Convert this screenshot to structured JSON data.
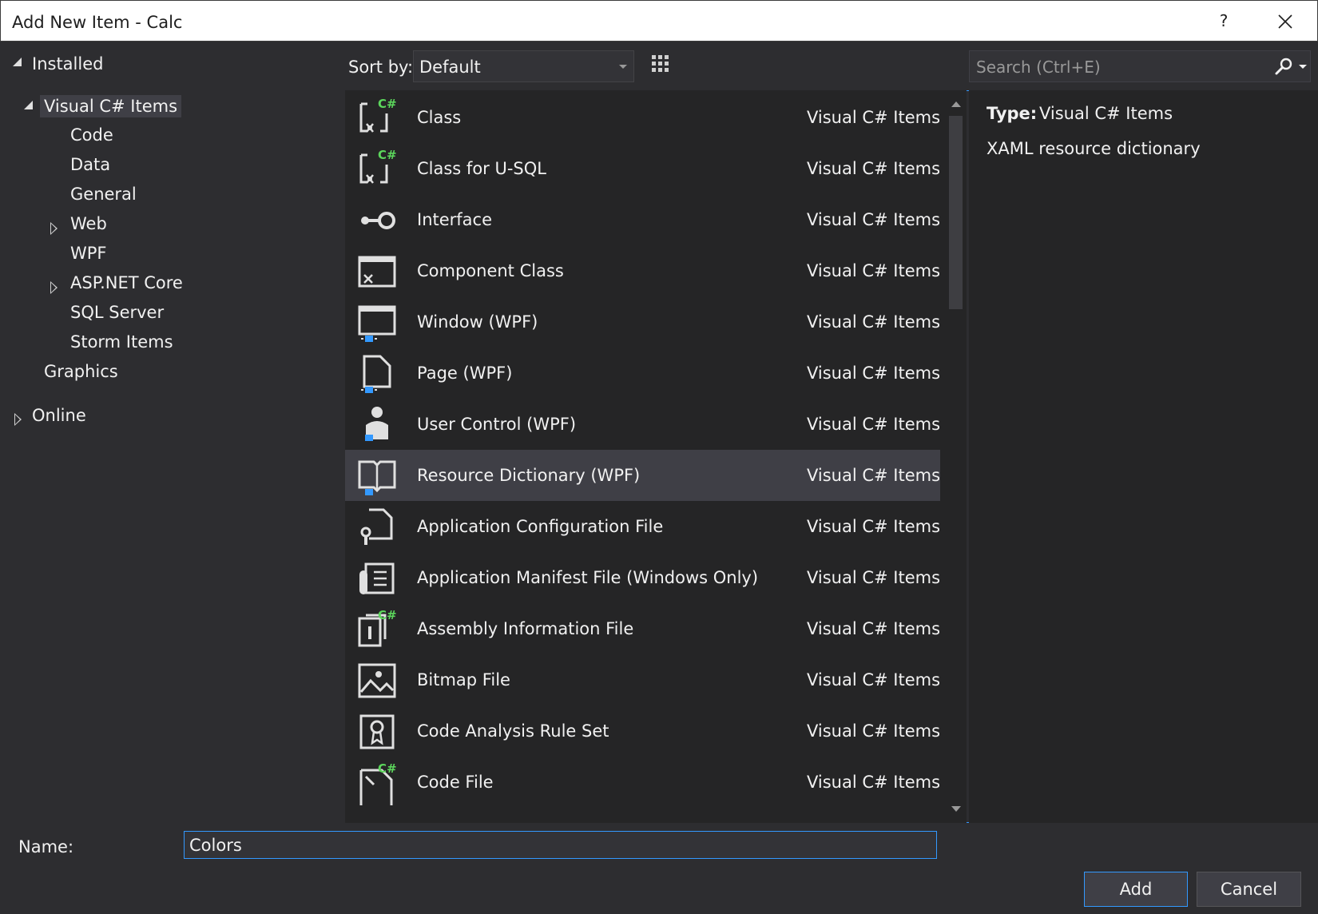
{
  "window": {
    "title": "Add New Item - Calc",
    "help_label": "?"
  },
  "tree": {
    "installed": "Installed",
    "visual_cs_items": "Visual C# Items",
    "children": [
      "Code",
      "Data",
      "General",
      "Web",
      "WPF",
      "ASP.NET Core",
      "SQL Server",
      "Storm Items"
    ],
    "graphics": "Graphics",
    "online": "Online"
  },
  "toolbar": {
    "sort_label": "Sort by:",
    "sort_value": "Default",
    "search_placeholder": "Search (Ctrl+E)"
  },
  "templates": [
    {
      "name": "Class",
      "type": "Visual C# Items",
      "icon": "class-icon"
    },
    {
      "name": "Class for U-SQL",
      "type": "Visual C# Items",
      "icon": "class-icon"
    },
    {
      "name": "Interface",
      "type": "Visual C# Items",
      "icon": "interface-icon"
    },
    {
      "name": "Component Class",
      "type": "Visual C# Items",
      "icon": "component-icon"
    },
    {
      "name": "Window (WPF)",
      "type": "Visual C# Items",
      "icon": "window-icon"
    },
    {
      "name": "Page (WPF)",
      "type": "Visual C# Items",
      "icon": "page-icon"
    },
    {
      "name": "User Control (WPF)",
      "type": "Visual C# Items",
      "icon": "user-control-icon"
    },
    {
      "name": "Resource Dictionary (WPF)",
      "type": "Visual C# Items",
      "icon": "book-icon"
    },
    {
      "name": "Application Configuration File",
      "type": "Visual C# Items",
      "icon": "config-icon"
    },
    {
      "name": "Application Manifest File (Windows Only)",
      "type": "Visual C# Items",
      "icon": "manifest-icon"
    },
    {
      "name": "Assembly Information File",
      "type": "Visual C# Items",
      "icon": "info-icon"
    },
    {
      "name": "Bitmap File",
      "type": "Visual C# Items",
      "icon": "image-icon"
    },
    {
      "name": "Code Analysis Rule Set",
      "type": "Visual C# Items",
      "icon": "ruleset-icon"
    },
    {
      "name": "Code File",
      "type": "Visual C# Items",
      "icon": "code-file-icon"
    }
  ],
  "details": {
    "type_label": "Type:",
    "type_value": "Visual C# Items",
    "description": "XAML resource dictionary"
  },
  "footer": {
    "name_label": "Name:",
    "name_value": "Colors",
    "add_label": "Add",
    "cancel_label": "Cancel"
  },
  "colors": {
    "background": "#2d2d30",
    "panel": "#252526",
    "selection": "#3f3f46",
    "accent": "#3399ff",
    "csharp_green": "#5cd65c"
  }
}
